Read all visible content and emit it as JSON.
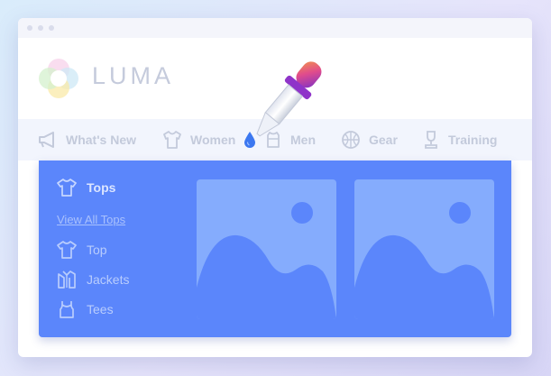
{
  "brand": {
    "name": "LUMA",
    "logo_icon": "luma-logo-icon"
  },
  "nav": {
    "items": [
      {
        "label": "What's New",
        "icon": "megaphone-icon"
      },
      {
        "label": "Women",
        "icon": "women-shirt-icon"
      },
      {
        "label": "Men",
        "icon": "men-shirt-icon"
      },
      {
        "label": "Gear",
        "icon": "basketball-icon"
      },
      {
        "label": "Training",
        "icon": "trophy-icon"
      }
    ]
  },
  "menu": {
    "heading": "Tops",
    "view_all": "View All Tops",
    "items": [
      {
        "label": "Top",
        "icon": "tshirt-icon"
      },
      {
        "label": "Jackets",
        "icon": "jacket-icon"
      },
      {
        "label": "Tees",
        "icon": "tank-top-icon"
      }
    ]
  },
  "colors": {
    "menu_background": "#5b86fb",
    "nav_text": "#c3cadb",
    "image_placeholder": "#85acfd",
    "color_picker_accent": "#b83fd9"
  },
  "overlay": {
    "tool_icon": "color-picker-dropper-icon",
    "drop_icon": "paint-drop-icon"
  }
}
